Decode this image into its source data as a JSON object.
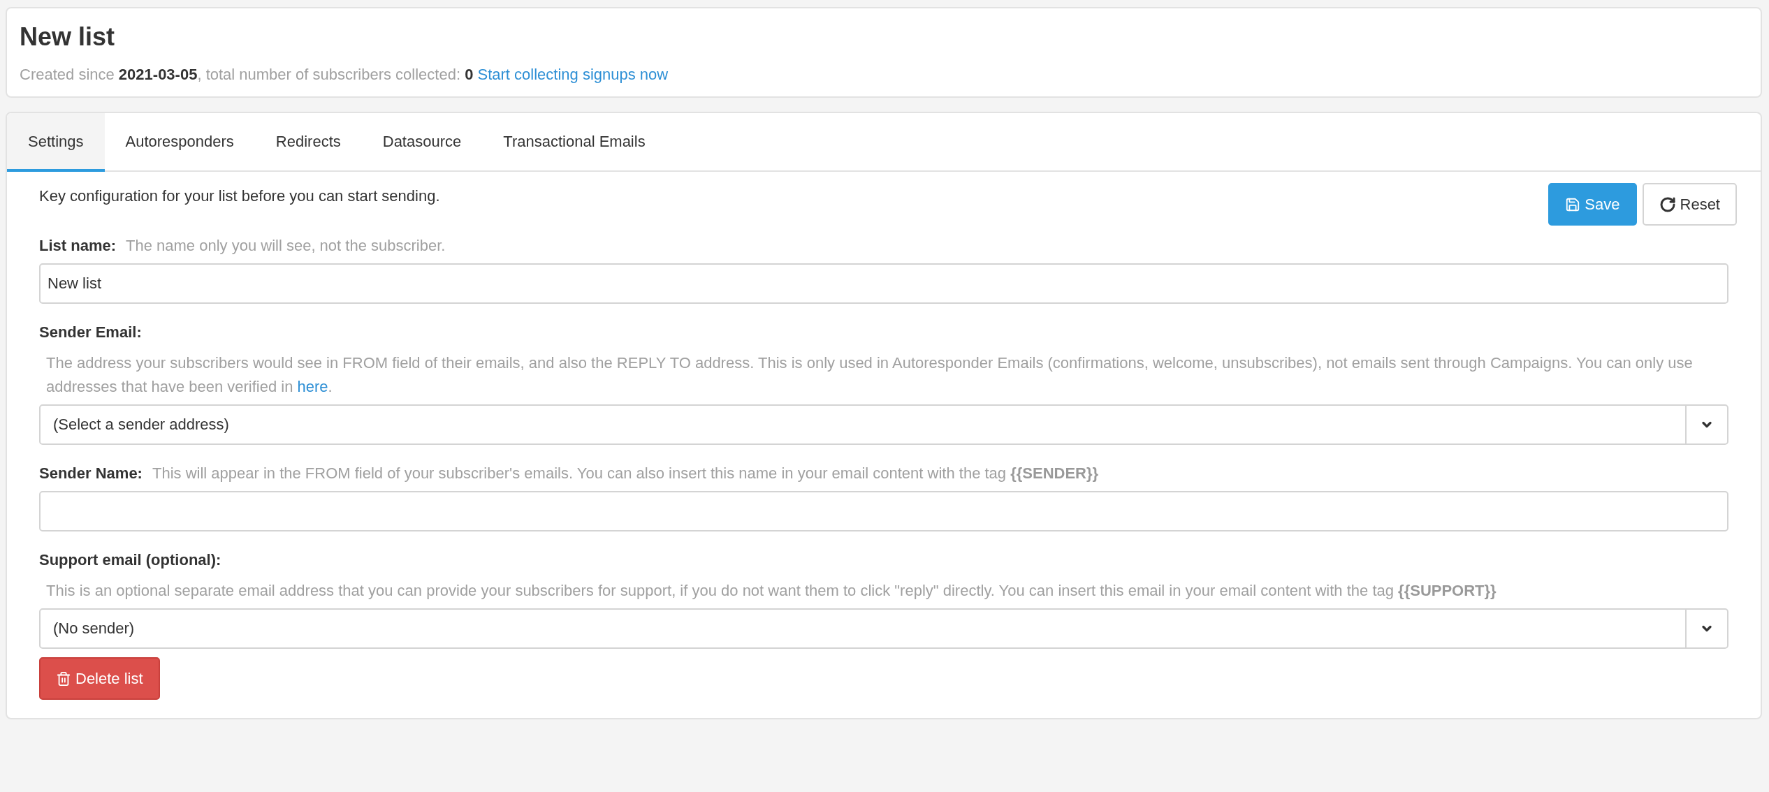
{
  "header": {
    "title": "New list",
    "summary": "Created since **2021-03-05**, total number of subscribers collected: **0**",
    "summary_link": "Start collecting signups now"
  },
  "tabs": [
    {
      "label": "Settings",
      "selected": true
    },
    {
      "label": "Autoresponders",
      "selected": false
    },
    {
      "label": "Redirects",
      "selected": false
    },
    {
      "label": "Datasource",
      "selected": false
    },
    {
      "label": "Transactional Emails",
      "selected": false
    }
  ],
  "intro": "Key configuration for your list before you can start sending.",
  "actions": {
    "save": "Save",
    "reset": "Reset"
  },
  "fields": [
    {
      "kind": "text",
      "label": "List name:",
      "hint_inline": "The name only you will see, not the subscriber.",
      "value": "New list"
    },
    {
      "kind": "select",
      "label": "Sender Email:",
      "help": "The address your subscribers would see in FROM field of their emails, and also the REPLY TO address. This is only used in Autoresponder Emails (confirmations, welcome, unsubscribes), not emails sent through Campaigns. You can only use addresses that have been verified in ",
      "help_link": "here",
      "help_after": ".",
      "value": "(Select a sender address)"
    },
    {
      "kind": "text",
      "label": "Sender Name:",
      "hint_inline": "This will appear in the FROM field of your subscriber's emails. You can also insert this name in your email content with the tag **{{SENDER}}**"
    },
    {
      "kind": "select",
      "label": "Support email (optional):",
      "help": "This is an optional separate email address that you can provide your subscribers for support, if you do not want them to click \"reply\" directly. You can insert this email in your email content with the tag **{{SUPPORT}}**",
      "value": "(No sender)"
    }
  ],
  "delete_button": "Delete list"
}
